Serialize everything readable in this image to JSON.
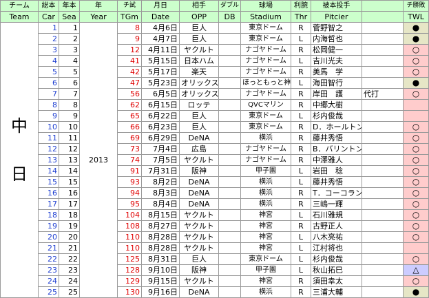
{
  "headers": {
    "jp": [
      "チーム",
      "総本",
      "年本",
      "年",
      "チ試",
      "月日",
      "相手",
      "ダブル",
      "球場",
      "利腕",
      "被本投手",
      "",
      "チ勝敗"
    ],
    "en": [
      "Team",
      "Car",
      "Sea",
      "Year",
      "TGm",
      "Date",
      "OPP",
      "DB",
      "Stadium",
      "Thr",
      "Pitcier",
      "",
      "TWL"
    ]
  },
  "team": {
    "char1": "中",
    "char2": "日"
  },
  "year": "2013",
  "rows": [
    {
      "car": "1",
      "sea": "1",
      "tgm": "8",
      "date": "4月6日",
      "opp": "巨人",
      "db": "",
      "stadium": "東京ドーム",
      "thr": "R",
      "pitcher": "菅野智之",
      "note": "",
      "twl": "●",
      "twl_type": "w"
    },
    {
      "car": "2",
      "sea": "2",
      "tgm": "9",
      "date": "4月7日",
      "opp": "巨人",
      "db": "",
      "stadium": "東京ドーム",
      "thr": "L",
      "pitcher": "内海哲也",
      "note": "",
      "twl": "●",
      "twl_type": "w"
    },
    {
      "car": "3",
      "sea": "3",
      "tgm": "12",
      "date": "4月11日",
      "opp": "ヤクルト",
      "db": "",
      "stadium": "ナゴヤドーム",
      "thr": "R",
      "pitcher": "松岡健一",
      "note": "",
      "twl": "○",
      "twl_type": "l"
    },
    {
      "car": "4",
      "sea": "4",
      "tgm": "41",
      "date": "5月15日",
      "opp": "日本ハム",
      "db": "",
      "stadium": "ナゴヤドーム",
      "thr": "L",
      "pitcher": "吉川光夫",
      "note": "",
      "twl": "○",
      "twl_type": "l"
    },
    {
      "car": "5",
      "sea": "5",
      "tgm": "42",
      "date": "5月17日",
      "opp": "楽天",
      "db": "",
      "stadium": "ナゴヤドーム",
      "thr": "R",
      "pitcher": "美馬　学",
      "note": "",
      "twl": "○",
      "twl_type": "l"
    },
    {
      "car": "6",
      "sea": "6",
      "tgm": "47",
      "date": "5月23日",
      "opp": "オリックス",
      "db": "",
      "stadium": "ほっともっと神戸",
      "thr": "L",
      "pitcher": "海田智行",
      "note": "",
      "twl": "●",
      "twl_type": "w"
    },
    {
      "car": "7",
      "sea": "7",
      "tgm": "56",
      "date": "6月5日",
      "opp": "オリックス",
      "db": "",
      "stadium": "ナゴヤドーム",
      "thr": "R",
      "pitcher": "岸田　護",
      "note": "代打",
      "twl": "○",
      "twl_type": "l"
    },
    {
      "car": "8",
      "sea": "8",
      "tgm": "62",
      "date": "6月15日",
      "opp": "ロッテ",
      "db": "",
      "stadium": "QVCマリン",
      "thr": "R",
      "pitcher": "中郷大樹",
      "note": "",
      "twl": "",
      "twl_type": "blank"
    },
    {
      "car": "9",
      "sea": "9",
      "tgm": "65",
      "date": "6月22日",
      "opp": "巨人",
      "db": "",
      "stadium": "東京ドーム",
      "thr": "L",
      "pitcher": "杉内俊哉",
      "note": "",
      "twl": "",
      "twl_type": "blank"
    },
    {
      "car": "10",
      "sea": "10",
      "tgm": "66",
      "date": "6月23日",
      "opp": "巨人",
      "db": "",
      "stadium": "東京ドーム",
      "thr": "R",
      "pitcher": "D．ホールトン",
      "note": "",
      "twl": "○",
      "twl_type": "l"
    },
    {
      "car": "11",
      "sea": "11",
      "tgm": "69",
      "date": "6月29日",
      "opp": "DeNA",
      "db": "",
      "stadium": "横浜",
      "thr": "R",
      "pitcher": "藤井秀悟",
      "note": "",
      "twl": "○",
      "twl_type": "l"
    },
    {
      "car": "12",
      "sea": "12",
      "tgm": "73",
      "date": "7月4日",
      "opp": "広島",
      "db": "",
      "stadium": "ナゴヤドーム",
      "thr": "R",
      "pitcher": "B．バリントン",
      "note": "",
      "twl": "○",
      "twl_type": "l"
    },
    {
      "car": "13",
      "sea": "13",
      "tgm": "74",
      "date": "7月5日",
      "opp": "ヤクルト",
      "db": "",
      "stadium": "ナゴヤドーム",
      "thr": "R",
      "pitcher": "中澤雅人",
      "note": "",
      "twl": "○",
      "twl_type": "l"
    },
    {
      "car": "14",
      "sea": "14",
      "tgm": "91",
      "date": "7月31日",
      "opp": "阪神",
      "db": "",
      "stadium": "甲子園",
      "thr": "L",
      "pitcher": "岩田　稔",
      "note": "",
      "twl": "○",
      "twl_type": "l"
    },
    {
      "car": "15",
      "sea": "15",
      "tgm": "93",
      "date": "8月2日",
      "opp": "DeNA",
      "db": "",
      "stadium": "横浜",
      "thr": "L",
      "pitcher": "藤井秀悟",
      "note": "",
      "twl": "○",
      "twl_type": "l"
    },
    {
      "car": "16",
      "sea": "16",
      "tgm": "94",
      "date": "8月3日",
      "opp": "DeNA",
      "db": "",
      "stadium": "横浜",
      "thr": "R",
      "pitcher": "T．コーコラン",
      "note": "",
      "twl": "○",
      "twl_type": "l"
    },
    {
      "car": "17",
      "sea": "17",
      "tgm": "95",
      "date": "8月4日",
      "opp": "DeNA",
      "db": "",
      "stadium": "横浜",
      "thr": "R",
      "pitcher": "三嶋一輝",
      "note": "",
      "twl": "○",
      "twl_type": "l"
    },
    {
      "car": "18",
      "sea": "18",
      "tgm": "104",
      "date": "8月15日",
      "opp": "ヤクルト",
      "db": "",
      "stadium": "神宮",
      "thr": "L",
      "pitcher": "石川雅規",
      "note": "",
      "twl": "○",
      "twl_type": "l"
    },
    {
      "car": "19",
      "sea": "19",
      "tgm": "108",
      "date": "8月27日",
      "opp": "ヤクルト",
      "db": "",
      "stadium": "神宮",
      "thr": "R",
      "pitcher": "古野正人",
      "note": "",
      "twl": "○",
      "twl_type": "l"
    },
    {
      "car": "20",
      "sea": "20",
      "tgm": "110",
      "date": "8月28日",
      "opp": "ヤクルト",
      "db": "",
      "stadium": "神宮",
      "thr": "L",
      "pitcher": "八木亮祐",
      "note": "",
      "twl": "○",
      "twl_type": "l"
    },
    {
      "car": "21",
      "sea": "21",
      "tgm": "110",
      "date": "8月28日",
      "opp": "ヤクルト",
      "db": "",
      "stadium": "神宮",
      "thr": "L",
      "pitcher": "江村将也",
      "note": "",
      "twl": "",
      "twl_type": "blank"
    },
    {
      "car": "22",
      "sea": "22",
      "tgm": "125",
      "date": "8月31日",
      "opp": "巨人",
      "db": "",
      "stadium": "東京ドーム",
      "thr": "L",
      "pitcher": "杉内俊哉",
      "note": "",
      "twl": "○",
      "twl_type": "l"
    },
    {
      "car": "23",
      "sea": "23",
      "tgm": "128",
      "date": "9月10日",
      "opp": "阪神",
      "db": "",
      "stadium": "甲子園",
      "thr": "L",
      "pitcher": "秋山拓巳",
      "note": "",
      "twl": "△",
      "twl_type": "d"
    },
    {
      "car": "24",
      "sea": "24",
      "tgm": "129",
      "date": "9月15日",
      "opp": "ヤクルト",
      "db": "",
      "stadium": "神宮",
      "thr": "R",
      "pitcher": "須田幸太",
      "note": "",
      "twl": "○",
      "twl_type": "l"
    },
    {
      "car": "25",
      "sea": "25",
      "tgm": "130",
      "date": "9月16日",
      "opp": "DeNA",
      "db": "",
      "stadium": "横浜",
      "thr": "R",
      "pitcher": "三浦大輔",
      "note": "",
      "twl": "●",
      "twl_type": "w"
    }
  ]
}
